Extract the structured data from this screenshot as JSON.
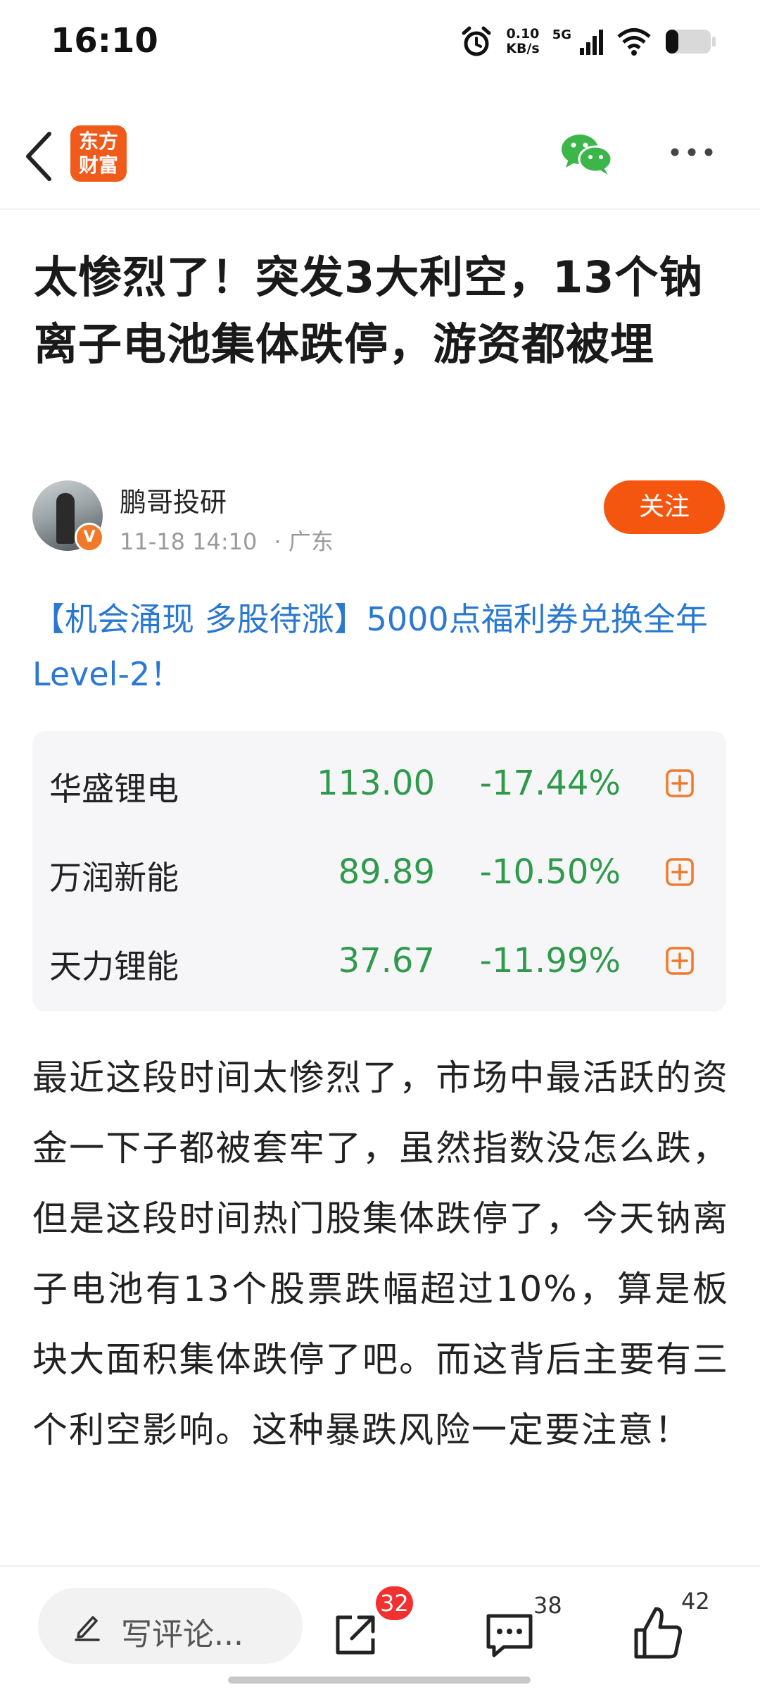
{
  "status_bar": {
    "time": "16:10",
    "net_speed_value": "0.10",
    "net_speed_unit": "KB/s",
    "signal_label": "5G",
    "icons": [
      "alarm-icon",
      "signal-icon",
      "wifi-icon",
      "battery-icon"
    ]
  },
  "nav": {
    "logo_line1": "东方",
    "logo_line2": "财富",
    "icons": [
      "back-icon",
      "wechat-icon",
      "more-icon"
    ],
    "brand_color": "#f05a1a"
  },
  "article": {
    "title": "太惨烈了！突发3大利空，13个钠离子电池集体跌停，游资都被埋",
    "author": "鹏哥投研",
    "verified_mark": "V",
    "datetime": "11-18 14:10",
    "location": "· 广东",
    "follow_label": "关注",
    "promo": "【机会涌现 多股待涨】5000点福利券兑换全年Level-2！",
    "body": "最近这段时间太惨烈了，市场中最活跃的资金一下子都被套牢了，虽然指数没怎么跌，但是这段时间热门股集体跌停了，今天钠离子电池有13个股票跌幅超过10%，算是板块大面积集体跌停了吧。而这背后主要有三个利空影响。这种暴跌风险一定要注意！"
  },
  "stocks": [
    {
      "name": "华盛锂电",
      "price": "113.00",
      "change": "-17.44%"
    },
    {
      "name": "万润新能",
      "price": "89.89",
      "change": "-10.50%"
    },
    {
      "name": "天力锂能",
      "price": "37.67",
      "change": "-11.99%"
    }
  ],
  "colors": {
    "accent": "#f5560f",
    "link": "#2a78d2",
    "down": "#2f9a4c",
    "badge": "#f23030"
  },
  "bottom_bar": {
    "comment_placeholder": "写评论...",
    "share_badge": "32",
    "comment_count": "38",
    "like_count": "42"
  }
}
